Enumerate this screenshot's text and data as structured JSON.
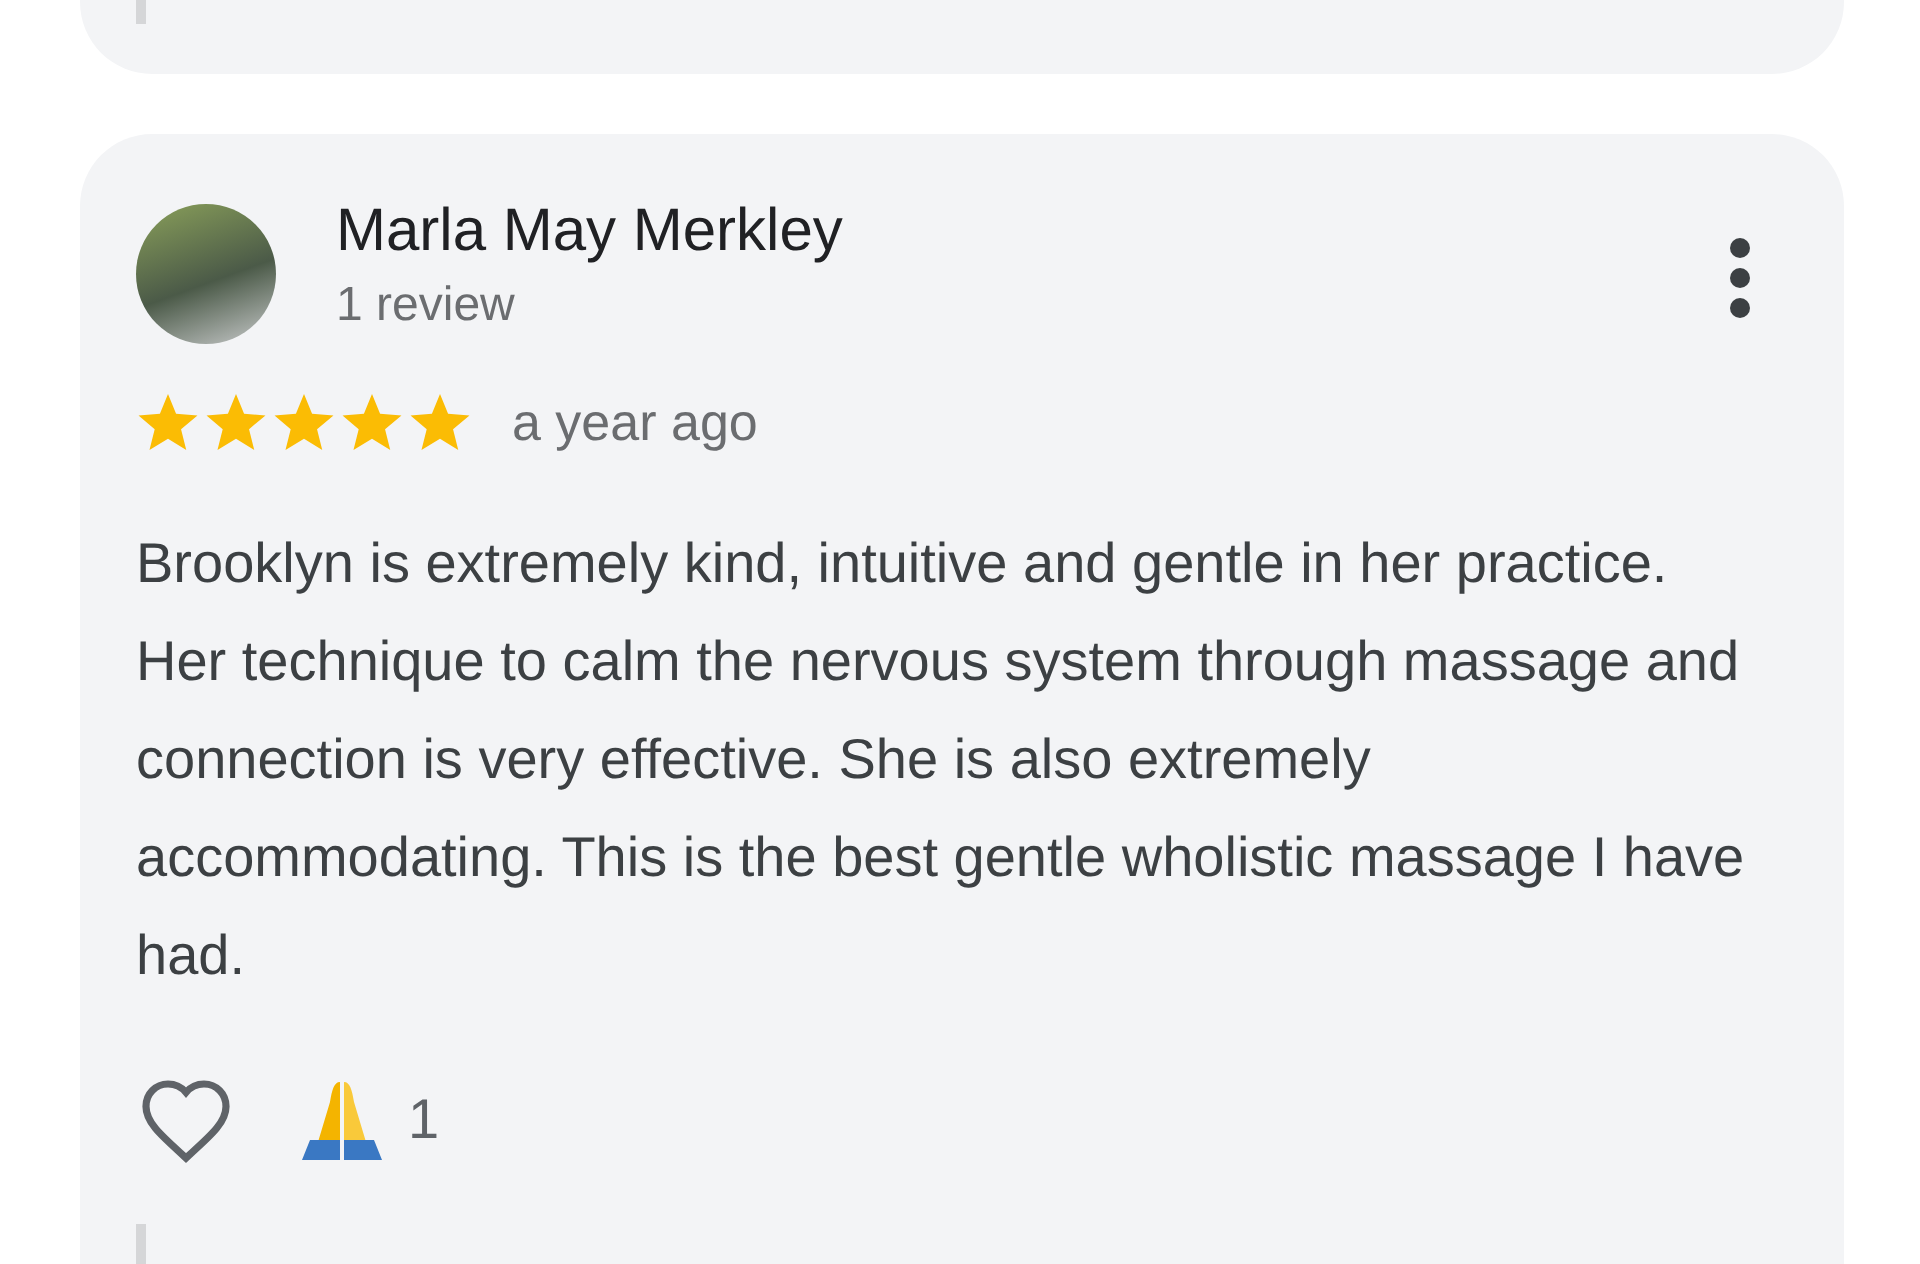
{
  "review": {
    "author": "Marla May Merkley",
    "review_count": "1 review",
    "stars": 5,
    "time": "a year ago",
    "text": "Brooklyn is extremely kind, intuitive and gentle in her practice. Her technique to calm the nervous system through massage and connection is very effective. She is also extremely accommodating. This is the best gentle wholistic massage I have had.",
    "liked": false,
    "reaction_count": "1"
  }
}
